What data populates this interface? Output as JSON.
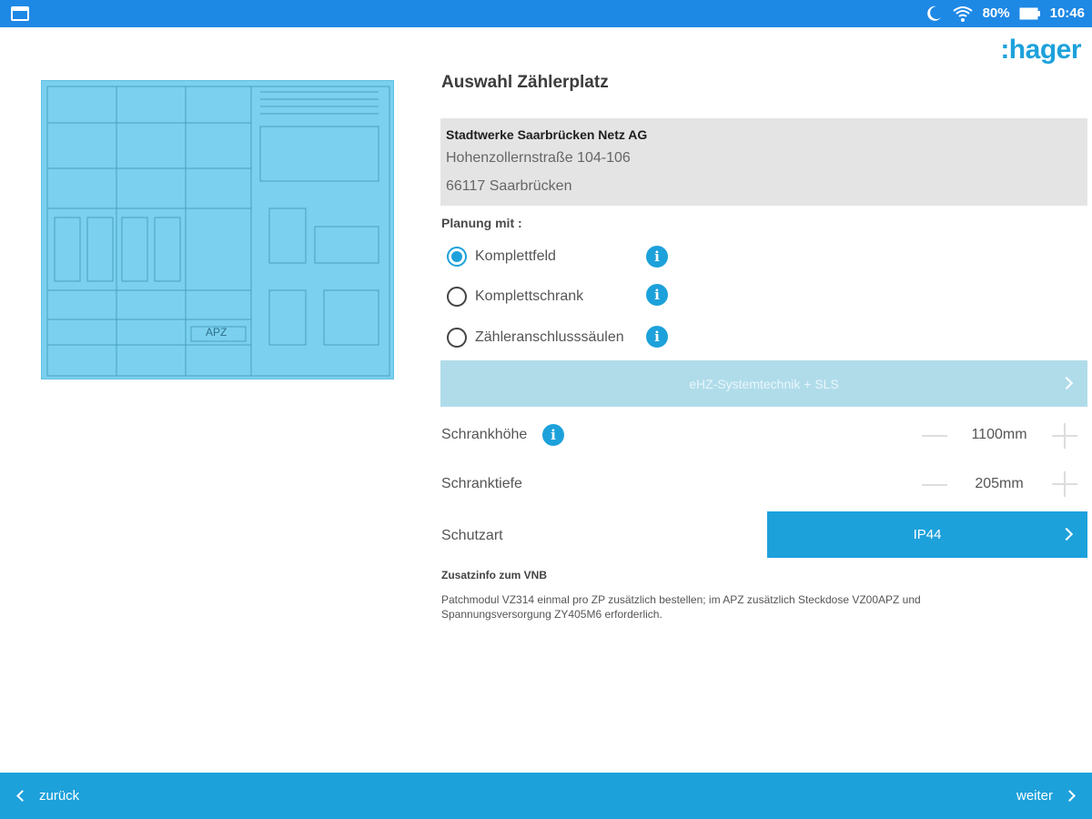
{
  "status_bar": {
    "battery": "80%",
    "time": "10:46",
    "icons": [
      "gallery-icon",
      "moon-icon",
      "wifi-icon",
      "battery-icon"
    ]
  },
  "brand": {
    "logo_text": ":hager",
    "accent": "#1da1db"
  },
  "diagram": {
    "label": "APZ"
  },
  "page": {
    "title": "Auswahl Zählerplatz"
  },
  "address": {
    "company": "Stadtwerke Saarbrücken Netz AG",
    "street": "Hohenzollernstraße 104-106",
    "city": "66117 Saarbrücken"
  },
  "planung": {
    "label": "Planung mit :",
    "options": [
      {
        "label": "Komplettfeld",
        "selected": true
      },
      {
        "label": "Komplettschrank",
        "selected": false
      },
      {
        "label": "Zähleranschlusssäulen",
        "selected": false
      }
    ]
  },
  "system_button": {
    "label": "eHZ-Systemtechnik + SLS"
  },
  "schrankhoehe": {
    "label": "Schrankhöhe",
    "value": "1100mm"
  },
  "schranktiefe": {
    "label": "Schranktiefe",
    "value": "205mm"
  },
  "schutzart": {
    "label": "Schutzart",
    "value": "IP44"
  },
  "zusatz": {
    "title": "Zusatzinfo zum VNB",
    "text": "Patchmodul VZ314 einmal pro ZP zusätzlich bestellen; im APZ zusätzlich Steckdose VZ00APZ und Spannungsversorgung ZY405M6 erforderlich."
  },
  "nav": {
    "back_label": "zurück",
    "next_label": "weiter"
  }
}
